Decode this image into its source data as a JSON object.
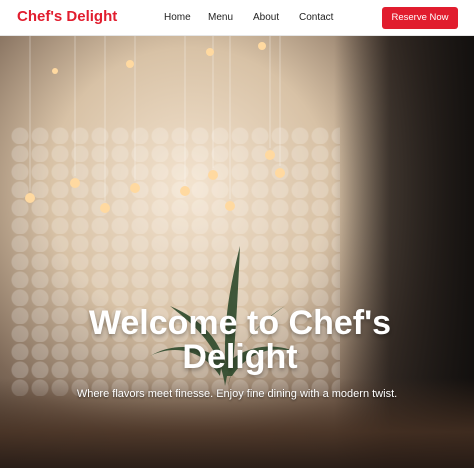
{
  "header": {
    "brand": "Chef's Delight",
    "nav": [
      "Home",
      "Menu",
      "About",
      "Contact"
    ],
    "cta": "Reserve Now"
  },
  "hero": {
    "title": "Welcome to Chef's Delight",
    "subtitle": "Where flavors meet finesse. Enjoy fine dining with a modern twist."
  },
  "colors": {
    "brand": "#e11d2e",
    "cta_background": "#e11d2e"
  }
}
